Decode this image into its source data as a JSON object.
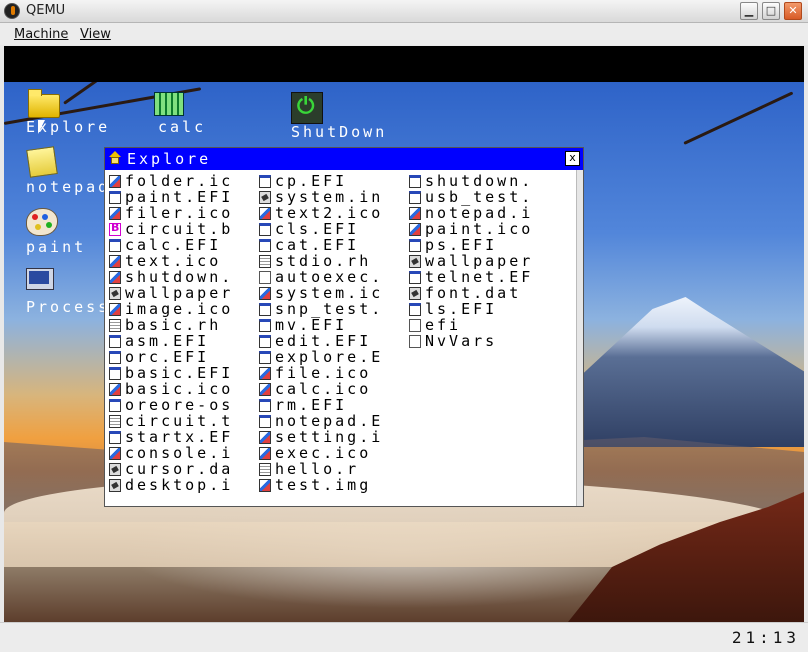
{
  "window": {
    "title": "QEMU"
  },
  "menubar": {
    "items": [
      "Machine",
      "View"
    ]
  },
  "desktop": {
    "icons": [
      {
        "label": "Explore",
        "icon": "folder-icon"
      },
      {
        "label": "calc",
        "icon": "calculator-icon"
      },
      {
        "label": "ShutDown",
        "icon": "power-icon"
      },
      {
        "label": "notepad",
        "icon": "notepad-icon"
      },
      {
        "label": "paint",
        "icon": "paint-palette-icon"
      },
      {
        "label": "Process",
        "icon": "process-monitor-icon"
      }
    ]
  },
  "explore": {
    "title": "Explore",
    "close": "x",
    "columns": [
      [
        {
          "name": "folder.ic",
          "type": "img"
        },
        {
          "name": "paint.EFI",
          "type": "exe"
        },
        {
          "name": "filer.ico",
          "type": "img"
        },
        {
          "name": "circuit.b",
          "type": "bmp"
        },
        {
          "name": "calc.EFI",
          "type": "exe"
        },
        {
          "name": "text.ico",
          "type": "img"
        },
        {
          "name": "shutdown.",
          "type": "img"
        },
        {
          "name": "wallpaper",
          "type": "dat"
        },
        {
          "name": "image.ico",
          "type": "img"
        },
        {
          "name": "basic.rh",
          "type": "doc"
        },
        {
          "name": "asm.EFI",
          "type": "exe"
        },
        {
          "name": "orc.EFI",
          "type": "exe"
        },
        {
          "name": "basic.EFI",
          "type": "exe"
        },
        {
          "name": "basic.ico",
          "type": "img"
        },
        {
          "name": "oreore-os",
          "type": "exe"
        },
        {
          "name": "circuit.t",
          "type": "doc"
        },
        {
          "name": "startx.EF",
          "type": "exe"
        },
        {
          "name": "console.i",
          "type": "img"
        },
        {
          "name": "cursor.da",
          "type": "dat"
        },
        {
          "name": "desktop.i",
          "type": "dat"
        }
      ],
      [
        {
          "name": "cp.EFI",
          "type": "exe"
        },
        {
          "name": "system.in",
          "type": "dat"
        },
        {
          "name": "text2.ico",
          "type": "img"
        },
        {
          "name": "cls.EFI",
          "type": "exe"
        },
        {
          "name": "cat.EFI",
          "type": "exe"
        },
        {
          "name": "stdio.rh",
          "type": "doc"
        },
        {
          "name": "autoexec.",
          "type": "blank"
        },
        {
          "name": "system.ic",
          "type": "img"
        },
        {
          "name": "snp_test.",
          "type": "exe"
        },
        {
          "name": "mv.EFI",
          "type": "exe"
        },
        {
          "name": "edit.EFI",
          "type": "exe"
        },
        {
          "name": "explore.E",
          "type": "exe"
        },
        {
          "name": "file.ico",
          "type": "img"
        },
        {
          "name": "calc.ico",
          "type": "img"
        },
        {
          "name": "rm.EFI",
          "type": "exe"
        },
        {
          "name": "notepad.E",
          "type": "exe"
        },
        {
          "name": "setting.i",
          "type": "img"
        },
        {
          "name": "exec.ico",
          "type": "img"
        },
        {
          "name": "hello.r",
          "type": "doc"
        },
        {
          "name": "test.img",
          "type": "img"
        }
      ],
      [
        {
          "name": "shutdown.",
          "type": "exe"
        },
        {
          "name": "usb_test.",
          "type": "exe"
        },
        {
          "name": "notepad.i",
          "type": "img"
        },
        {
          "name": "paint.ico",
          "type": "img"
        },
        {
          "name": "ps.EFI",
          "type": "exe"
        },
        {
          "name": "wallpaper",
          "type": "dat"
        },
        {
          "name": "telnet.EF",
          "type": "exe"
        },
        {
          "name": "font.dat",
          "type": "dat"
        },
        {
          "name": "ls.EFI",
          "type": "exe"
        },
        {
          "name": "efi",
          "type": "blank"
        },
        {
          "name": "NvVars",
          "type": "blank"
        }
      ]
    ]
  },
  "status": {
    "clock": "21:13"
  }
}
